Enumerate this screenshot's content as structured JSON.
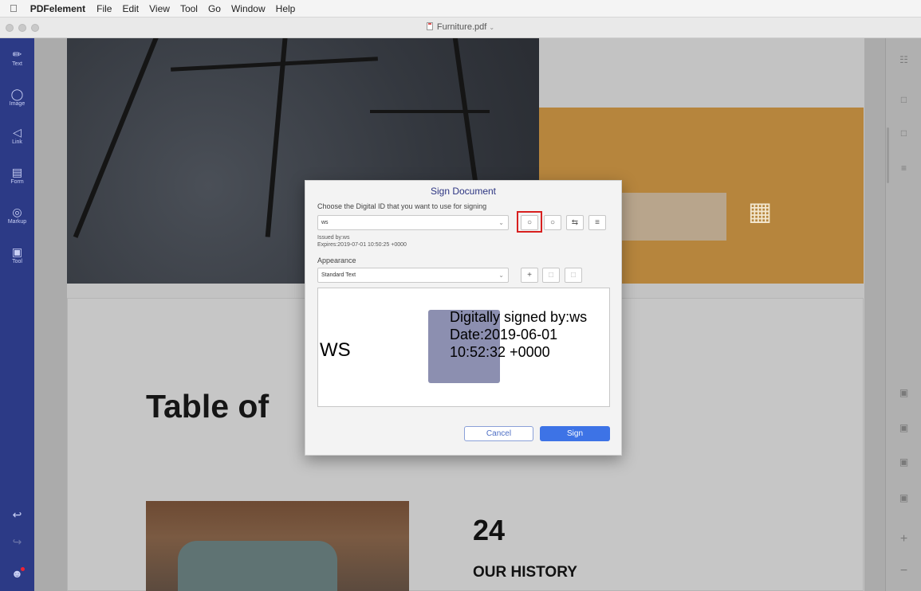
{
  "menubar": {
    "app_name": "PDFelement",
    "items": [
      "File",
      "Edit",
      "View",
      "Tool",
      "Go",
      "Window",
      "Help"
    ]
  },
  "window": {
    "document_title": "Furniture.pdf"
  },
  "left_tools": [
    {
      "label": "Text",
      "icon": "pencil-icon"
    },
    {
      "label": "Image",
      "icon": "image-icon"
    },
    {
      "label": "Link",
      "icon": "link-icon"
    },
    {
      "label": "Form",
      "icon": "form-icon"
    },
    {
      "label": "Markup",
      "icon": "markup-icon"
    },
    {
      "label": "Tool",
      "icon": "tool-icon"
    }
  ],
  "document": {
    "toc_title": "Table of",
    "history_number": "24",
    "history_label": "OUR HISTORY"
  },
  "dialog": {
    "title": "Sign Document",
    "choose_label": "Choose the Digital ID that you want to use for signing",
    "id_value": "ws",
    "issued_by": "Issued by:ws",
    "expires": "Expires:2019-07-01 10:50:25 +0000",
    "appearance_label": "Appearance",
    "appearance_value": "Standard Text",
    "preview_name": "WS",
    "preview_text": "Digitally signed by:ws\nDate:2019-06-01\n10:52:32 +0000",
    "cancel_label": "Cancel",
    "sign_label": "Sign"
  },
  "colors": {
    "sidebar": "#2c3a86",
    "accent": "#3d73e6",
    "highlight": "#d8201f",
    "orange": "#b6853d"
  }
}
